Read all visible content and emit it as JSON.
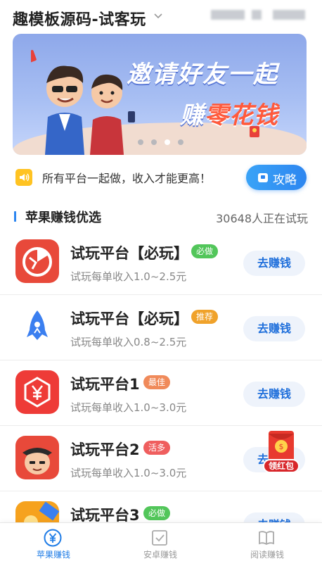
{
  "header": {
    "title": "趣模板源码-试客玩"
  },
  "banner": {
    "line1": "邀请好友一起",
    "line2_prefix": "赚",
    "line2_highlight": "零花钱",
    "active_dot": 3,
    "dot_count": 4
  },
  "notice": {
    "text": "所有平台一起做，收入才能更高！",
    "guide_label": "攻略"
  },
  "section": {
    "title": "苹果赚钱优选",
    "count_text": "30648人正在试玩"
  },
  "apps": [
    {
      "title": "试玩平台【必玩】",
      "badge": "必做",
      "badge_color": "#52c65a",
      "subtitle": "试玩每单收入1.0~2.5元",
      "button": "去赚钱",
      "icon": "pie-chart-icon"
    },
    {
      "title": "试玩平台【必玩】",
      "badge": "推荐",
      "badge_color": "#f0a22a",
      "subtitle": "试玩每单收入0.8~2.5元",
      "button": "去赚钱",
      "icon": "rocket-icon"
    },
    {
      "title": "试玩平台1",
      "badge": "最佳",
      "badge_color": "#f08a5a",
      "subtitle": "试玩每单收入1.0~3.0元",
      "button": "去赚钱",
      "icon": "yuan-shield-icon"
    },
    {
      "title": "试玩平台2",
      "badge": "活多",
      "badge_color": "#ef5e5e",
      "subtitle": "试玩每单收入1.0~3.0元",
      "button": "去赚钱",
      "icon": "cartoon-face-icon"
    },
    {
      "title": "试玩平台3",
      "badge": "必做",
      "badge_color": "#52c65a",
      "subtitle": "",
      "button": "去赚钱",
      "icon": "coins-icon"
    }
  ],
  "red_packet": {
    "label": "领红包"
  },
  "tabbar": {
    "items": [
      {
        "label": "苹果赚钱",
        "icon": "yuan-circle-icon",
        "active": true
      },
      {
        "label": "安卓赚钱",
        "icon": "check-box-icon",
        "active": false
      },
      {
        "label": "阅读赚钱",
        "icon": "book-icon",
        "active": false
      }
    ]
  },
  "colors": {
    "accent": "#2d86f0",
    "active_tab": "#1f7ce6",
    "notice_icon": "#ffc322"
  }
}
